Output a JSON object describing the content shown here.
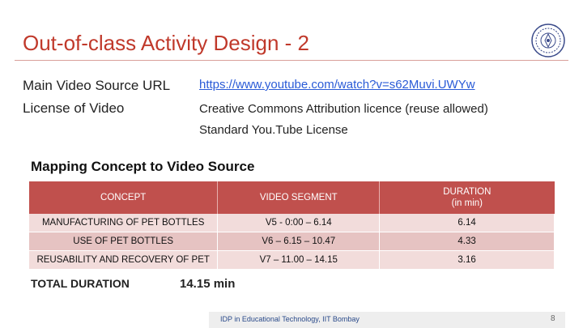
{
  "slide": {
    "title": "Out-of-class Activity Design - 2",
    "logo_icon": "institute-seal-icon",
    "accent_color": "#c0392b"
  },
  "info": {
    "video_source_label": "Main Video Source URL",
    "video_source_url": "https://www.youtube.com/watch?v=s62Muvi.UWYw",
    "license_label": "License of Video",
    "license_line1": "Creative Commons Attribution licence (reuse allowed)",
    "license_line2": "Standard You.Tube License"
  },
  "mapping": {
    "section_title": "Mapping Concept to Video Source",
    "header_color": "#c0504d",
    "headers": {
      "concept": "CONCEPT",
      "segment": "VIDEO SEGMENT",
      "duration_line1": "DURATION",
      "duration_line2": "(in min)"
    },
    "rows": [
      {
        "concept": "MANUFACTURING OF PET BOTTLES",
        "segment": "V5 - 0:00 – 6.14",
        "duration": "6.14"
      },
      {
        "concept": "USE OF PET BOTTLES",
        "segment": "V6 – 6.15 – 10.47",
        "duration": "4.33"
      },
      {
        "concept": "REUSABILITY AND RECOVERY OF PET",
        "segment": "V7 – 11.00 – 14.15",
        "duration": "3.16"
      }
    ],
    "total_label": "TOTAL DURATION",
    "total_value": "14.15 min"
  },
  "footer": {
    "text": "IDP in Educational Technology, IIT Bombay",
    "page_number": "8"
  }
}
